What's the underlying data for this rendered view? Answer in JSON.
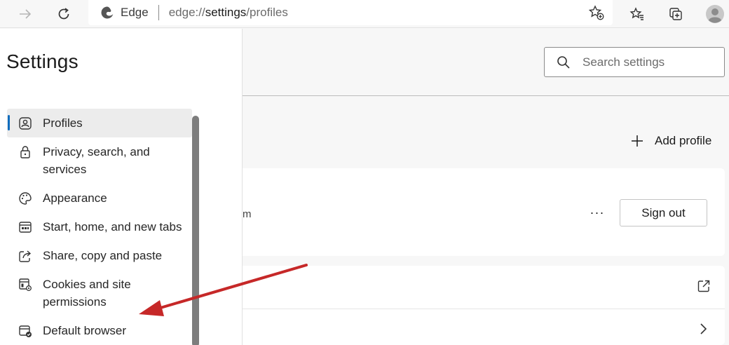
{
  "browser": {
    "site_name": "Edge",
    "url_prefix": "edge://",
    "url_host": "settings",
    "url_path": "/profiles"
  },
  "sidebar": {
    "title": "Settings",
    "items": [
      {
        "label": "Profiles",
        "icon": "profile-icon",
        "active": true
      },
      {
        "label": "Privacy, search, and services",
        "icon": "lock-icon",
        "active": false
      },
      {
        "label": "Appearance",
        "icon": "palette-icon",
        "active": false
      },
      {
        "label": "Start, home, and new tabs",
        "icon": "home-tabs-icon",
        "active": false
      },
      {
        "label": "Share, copy and paste",
        "icon": "share-icon",
        "active": false
      },
      {
        "label": "Cookies and site permissions",
        "icon": "cookies-icon",
        "active": false
      },
      {
        "label": "Default browser",
        "icon": "default-browser-icon",
        "active": false
      }
    ]
  },
  "search": {
    "placeholder": "Search settings"
  },
  "main": {
    "add_profile_label": "Add profile",
    "email_fragment": "m",
    "more_label": "···",
    "sign_out_label": "Sign out"
  },
  "colors": {
    "accent": "#0f6cbd",
    "arrow": "#c62828"
  }
}
